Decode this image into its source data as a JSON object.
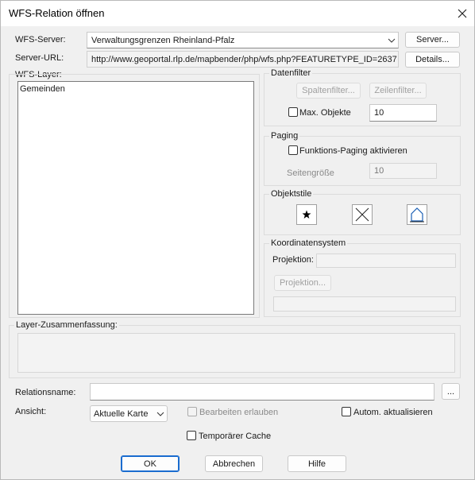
{
  "window": {
    "title": "WFS-Relation öffnen"
  },
  "server": {
    "label": "WFS-Server:",
    "value": "Verwaltungsgrenzen Rheinland-Pfalz",
    "button": "Server..."
  },
  "url": {
    "label": "Server-URL:",
    "value": "http://www.geoportal.rlp.de/mapbender/php/wfs.php?FEATURETYPE_ID=2637",
    "button": "Details..."
  },
  "layers": {
    "label": "WFS-Layer:",
    "items": [
      "Gemeinden"
    ]
  },
  "datenfilter": {
    "label": "Datenfilter",
    "spalten": "Spaltenfilter...",
    "zeilen": "Zeilenfilter...",
    "max_label": "Max. Objekte",
    "max_value": "10"
  },
  "paging": {
    "label": "Paging",
    "checkbox": "Funktions-Paging aktivieren",
    "size_label": "Seitengröße",
    "size_value": "10"
  },
  "objektstile": {
    "label": "Objektstile"
  },
  "koordinaten": {
    "label": "Koordinatensystem",
    "projektion_label": "Projektion:",
    "button": "Projektion..."
  },
  "summary": {
    "label": "Layer-Zusammenfassung:"
  },
  "relation": {
    "label": "Relationsname:",
    "value": "",
    "button": "..."
  },
  "ansicht": {
    "label": "Ansicht:",
    "value": "Aktuelle Karte",
    "edit": "Bearbeiten erlauben",
    "auto": "Autom. aktualisieren"
  },
  "cache": {
    "label": "Temporärer Cache"
  },
  "buttons": {
    "ok": "OK",
    "cancel": "Abbrechen",
    "help": "Hilfe"
  }
}
